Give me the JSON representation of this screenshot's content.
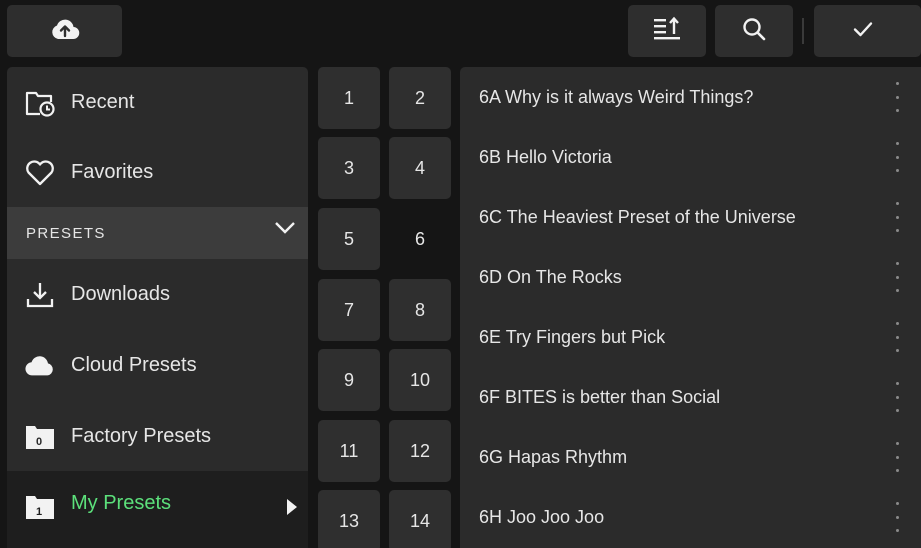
{
  "toolbar": {
    "upload_icon": "cloud-upload-icon",
    "sort_icon": "sort-icon",
    "search_icon": "search-icon",
    "confirm_icon": "checkmark-icon"
  },
  "sidebar": {
    "items": [
      {
        "label": "Recent",
        "icon": "recent-folder-icon"
      },
      {
        "label": "Favorites",
        "icon": "heart-icon"
      }
    ],
    "presets_header": "PRESETS",
    "preset_items": [
      {
        "label": "Downloads",
        "icon": "download-icon"
      },
      {
        "label": "Cloud Presets",
        "icon": "cloud-icon"
      },
      {
        "label": "Factory Presets",
        "icon": "folder-icon",
        "badge": "0"
      },
      {
        "label": "My Presets",
        "icon": "folder-icon",
        "badge": "1",
        "selected": true
      }
    ]
  },
  "banks": [
    "1",
    "2",
    "3",
    "4",
    "5",
    "6",
    "7",
    "8",
    "9",
    "10",
    "11",
    "12",
    "13",
    "14"
  ],
  "selected_bank": "6",
  "presets": [
    "6A Why is it always Weird Things?",
    "6B Hello Victoria",
    "6C The Heaviest Preset of the Universe",
    "6D On The Rocks",
    "6E Try Fingers but Pick",
    "6F BITES is better than Social",
    "6G Hapas Rhythm",
    "6H Joo Joo Joo"
  ],
  "colors": {
    "background": "#151515",
    "panel": "#2b2b2b",
    "accent": "#5ce07b"
  }
}
